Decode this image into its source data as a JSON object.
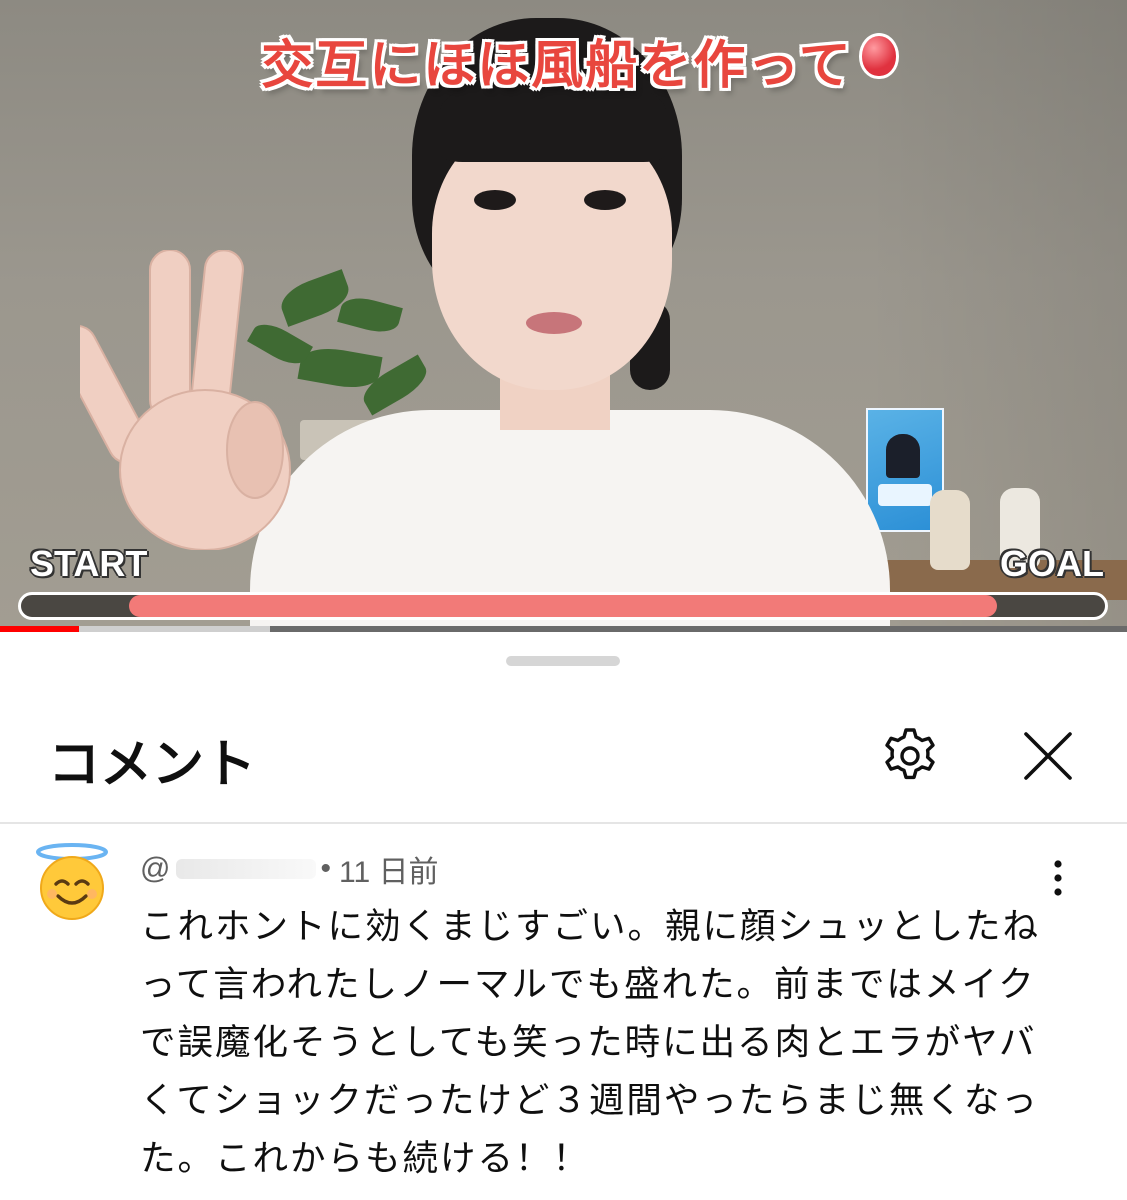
{
  "video": {
    "caption": "交互にほほ風船を作って",
    "start_label": "START",
    "goal_label": "GOAL",
    "exercise_progress": 0.9,
    "exercise_progress_start": 0.1,
    "playback_progress": 0.07,
    "buffered_progress": 0.24
  },
  "comments_panel": {
    "title": "コメント",
    "settings_icon": "gear-icon",
    "close_icon": "close-icon"
  },
  "comment": {
    "handle_prefix": "@",
    "time_ago": "11 日前",
    "avatar_icon": "smiling-face-with-halo-emoji",
    "text": "これホントに効くまじすごい。親に顔シュッとしたねって言われたしノーマルでも盛れた。前まではメイクで誤魔化そうとしても笑った時に出る肉とエラがヤバくてショックだったけど３週間やったらまじ無くなった。これからも続ける！！"
  },
  "colors": {
    "caption_red": "#e8463e",
    "progress_fill": "#f27a78",
    "youtube_red": "#ff0000"
  }
}
